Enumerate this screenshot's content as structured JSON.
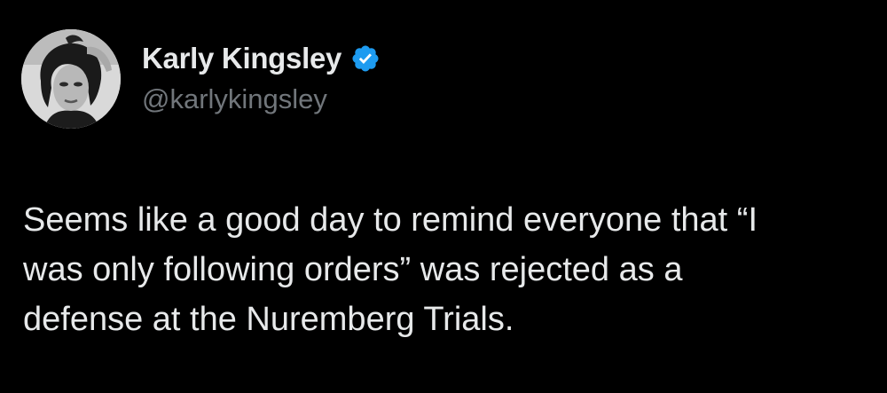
{
  "author": {
    "display_name": "Karly Kingsley",
    "handle": "@karlykingsley",
    "verified": true
  },
  "tweet": {
    "text_lines": [
      "Seems like a good day to remind everyone that “I",
      "was only following orders” was rejected as a",
      "defense at the Nuremberg Trials."
    ]
  },
  "colors": {
    "background": "#000000",
    "primary_text": "#e7e9ea",
    "secondary_text": "#71767b",
    "verified_badge": "#1d9bf0"
  },
  "icons": {
    "avatar": "avatar-photo",
    "badge": "verified-badge-icon"
  }
}
